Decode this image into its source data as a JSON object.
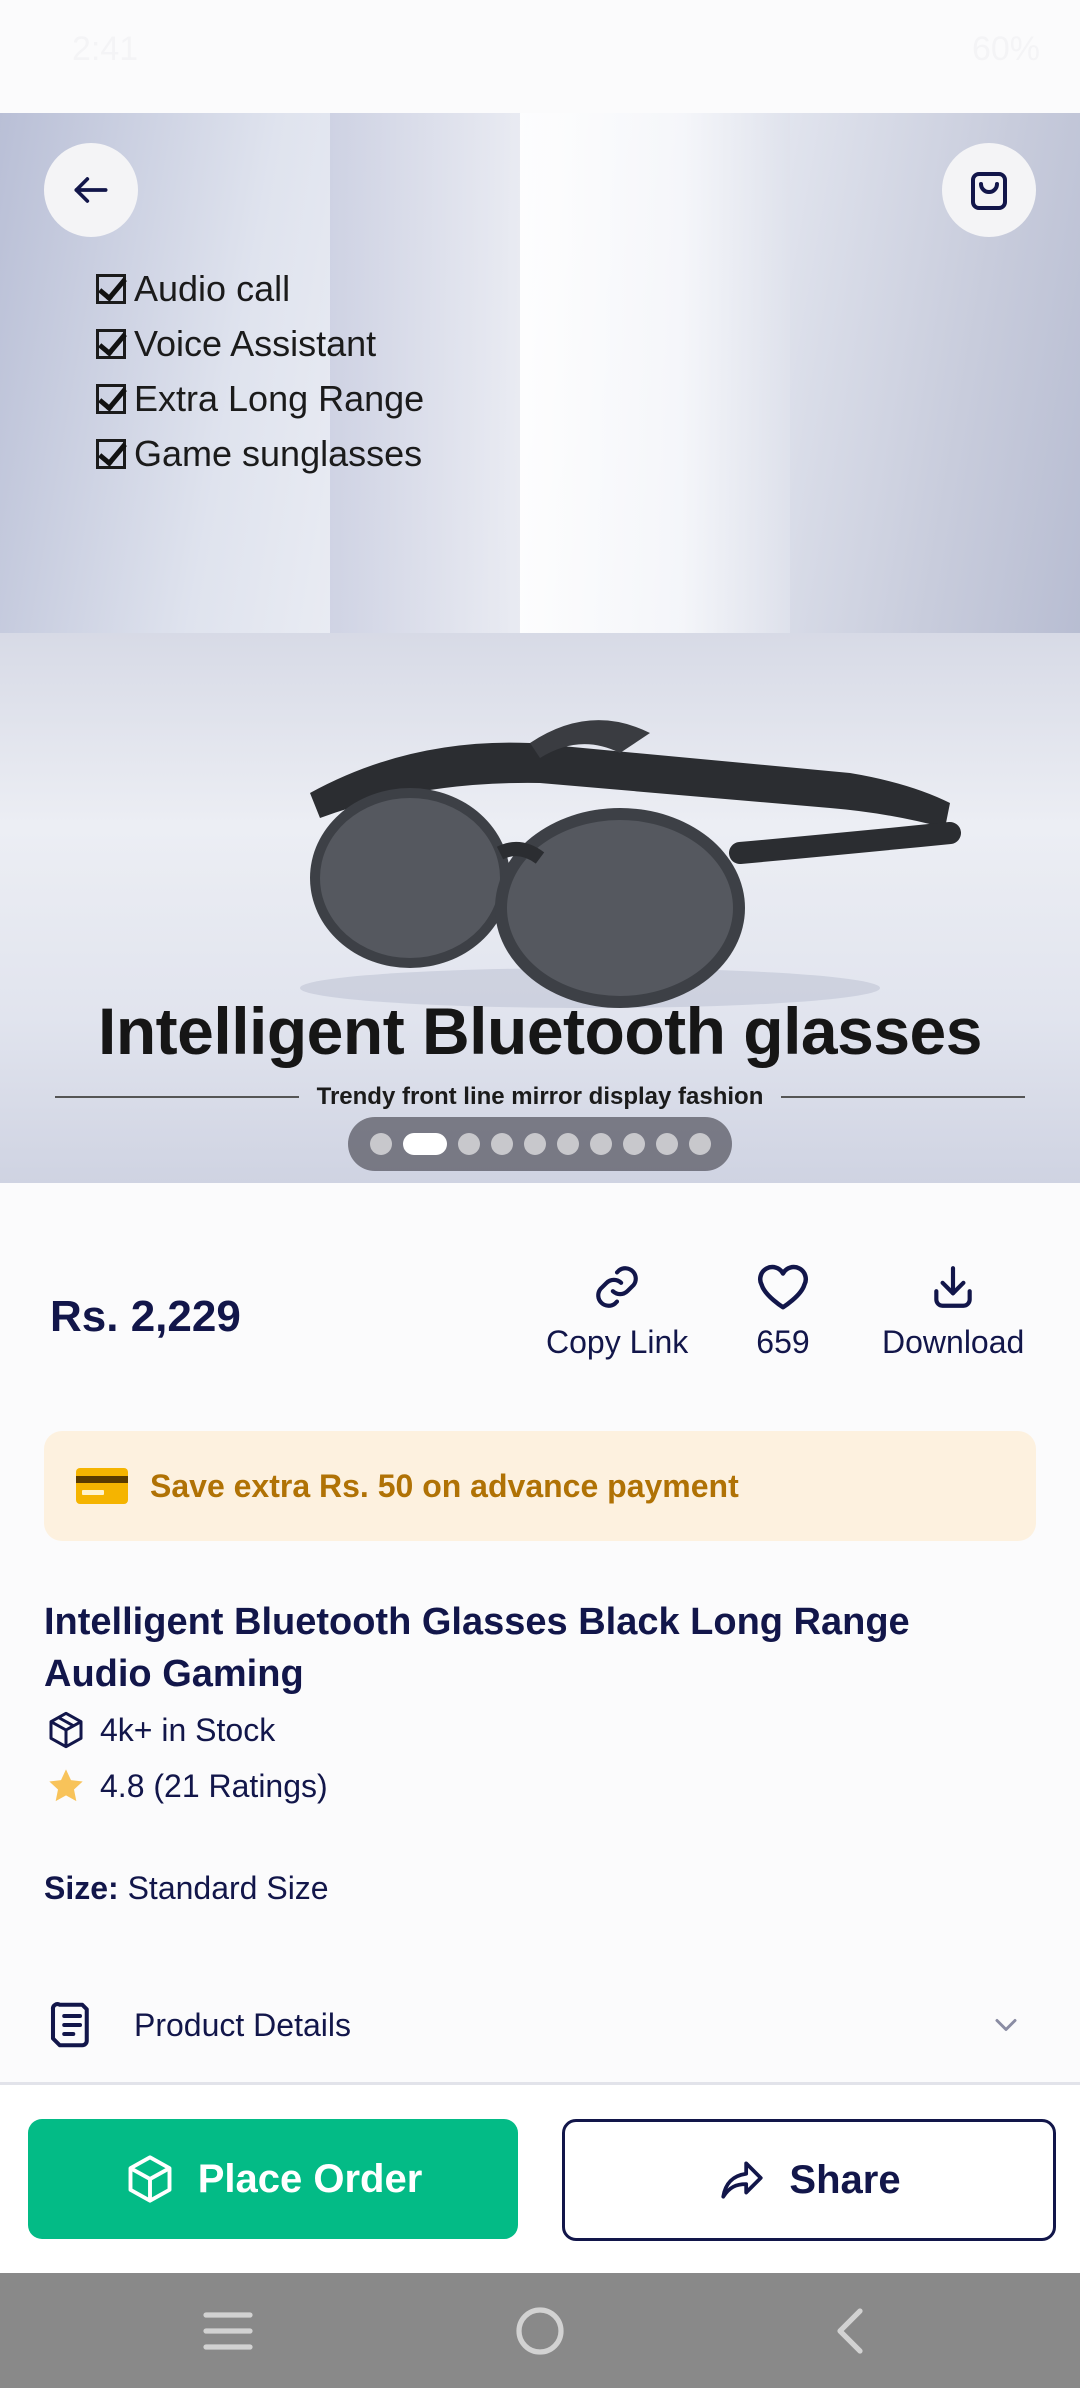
{
  "status_bar": {
    "time": "2:41",
    "battery": "60%"
  },
  "hero": {
    "features": [
      "Audio call",
      "Voice Assistant",
      "Extra Long Range",
      "Game sunglasses"
    ],
    "title": "Intelligent Bluetooth glasses",
    "subtitle": "Trendy front line mirror display fashion",
    "carousel": {
      "total": 10,
      "active_index": 1
    }
  },
  "header": {
    "back_icon": "arrow-left-icon",
    "cart_icon": "shopping-bag-icon"
  },
  "price": "Rs. 2,229",
  "actions": [
    {
      "icon": "link-icon",
      "label": "Copy Link"
    },
    {
      "icon": "heart-icon",
      "label": "659"
    },
    {
      "icon": "download-icon",
      "label": "Download"
    }
  ],
  "promo": {
    "icon": "credit-card-icon",
    "text": "Save extra Rs. 50 on advance payment",
    "text_color": "#b07205",
    "background": "#fdf1df"
  },
  "product": {
    "title": "Intelligent Bluetooth Glasses Black Long Range Audio Gaming",
    "stock": "4k+ in Stock",
    "rating": "4.8 (21 Ratings)"
  },
  "size": {
    "label": "Size:",
    "value": "Standard Size"
  },
  "details": {
    "label": "Product Details"
  },
  "buttons": {
    "order": "Place Order",
    "share": "Share"
  },
  "colors": {
    "primary": "#12164a",
    "accent": "#03bb86",
    "star": "#f8c35a"
  }
}
